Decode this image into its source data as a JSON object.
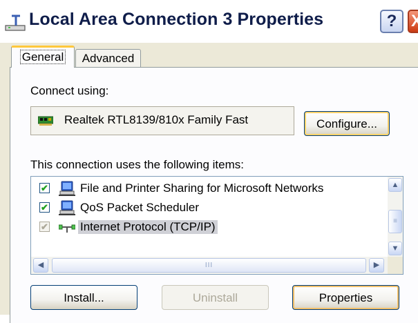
{
  "window": {
    "title": "Local Area Connection 3 Properties",
    "help_label": "?",
    "close_label": "X"
  },
  "tabs": [
    {
      "label": "General",
      "selected": true
    },
    {
      "label": "Advanced",
      "selected": false
    }
  ],
  "general": {
    "connect_using_label": "Connect using:",
    "adapter_name": "Realtek RTL8139/810x Family Fast",
    "configure_label": "Configure...",
    "items_label": "This connection uses the following items:",
    "items": [
      {
        "label": "File and Printer Sharing for Microsoft Networks",
        "checked": true,
        "icon": "network-computer-icon"
      },
      {
        "label": "QoS Packet Scheduler",
        "checked": true,
        "icon": "network-computer-icon"
      },
      {
        "label": "Internet Protocol (TCP/IP)",
        "checked": true,
        "disabled": true,
        "selected": true,
        "icon": "protocol-icon"
      }
    ],
    "install_label": "Install...",
    "uninstall_label": "Uninstall",
    "properties_label": "Properties"
  },
  "scrollbars": {
    "up_glyph": "▲",
    "down_glyph": "▼",
    "left_glyph": "◀",
    "right_glyph": "▶",
    "grip_glyph": "≡",
    "hgrip_glyph": "III"
  },
  "colors": {
    "dialog_bg": "#ece9d8",
    "title_text": "#0f1d4a",
    "selection_bg": "#cfd0d6",
    "check_green": "#21a121"
  }
}
